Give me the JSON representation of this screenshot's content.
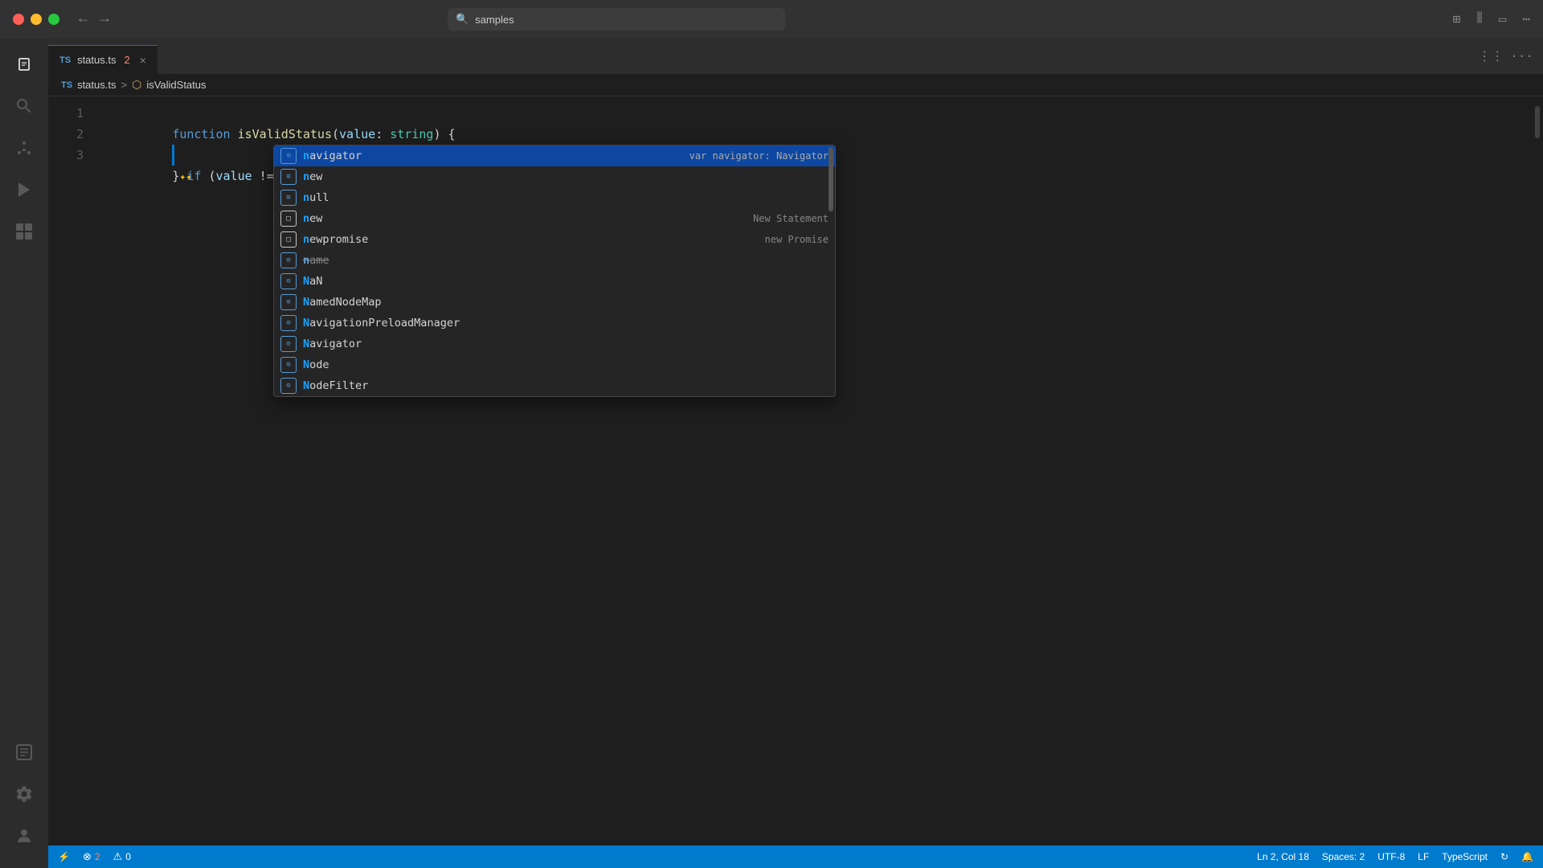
{
  "titlebar": {
    "search_placeholder": "samples",
    "nav_back": "←",
    "nav_forward": "→"
  },
  "tab": {
    "ts_label": "TS",
    "filename": "status.ts",
    "dirty_marker": "2",
    "close": "×"
  },
  "breadcrumb": {
    "ts_label": "TS",
    "file": "status.ts",
    "sep": ">",
    "func": "isValidStatus"
  },
  "editor": {
    "lines": [
      {
        "num": "1",
        "content": "function_line"
      },
      {
        "num": "2",
        "content": "if_line"
      },
      {
        "num": "3",
        "content": "close_line"
      }
    ]
  },
  "autocomplete": {
    "items": [
      {
        "icon": "var",
        "icon_type": "var",
        "label": "navigator",
        "match": "n",
        "detail": "var navigator: Navigator",
        "selected": true
      },
      {
        "icon": "kw",
        "icon_type": "keyword",
        "label": "new",
        "match": "n",
        "detail": "",
        "selected": false
      },
      {
        "icon": "kw",
        "icon_type": "keyword",
        "label": "null",
        "match": "n",
        "detail": "",
        "selected": false
      },
      {
        "icon": "snip",
        "icon_type": "snippet",
        "label": "new",
        "match": "n",
        "detail": "New Statement",
        "selected": false
      },
      {
        "icon": "snip",
        "icon_type": "snippet",
        "label": "newpromise",
        "match": "n",
        "detail": "new Promise",
        "selected": false
      },
      {
        "icon": "var",
        "icon_type": "var",
        "label": "name",
        "match": "n",
        "detail": "",
        "selected": false,
        "strikethrough": true
      },
      {
        "icon": "var",
        "icon_type": "var",
        "label": "NaN",
        "match": "n",
        "detail": "",
        "selected": false
      },
      {
        "icon": "var",
        "icon_type": "var",
        "label": "NamedNodeMap",
        "match": "n",
        "detail": "",
        "selected": false
      },
      {
        "icon": "var",
        "icon_type": "var",
        "label": "NavigationPreloadManager",
        "match": "n",
        "detail": "",
        "selected": false
      },
      {
        "icon": "var",
        "icon_type": "var",
        "label": "Navigator",
        "match": "n",
        "detail": "",
        "selected": false
      },
      {
        "icon": "var",
        "icon_type": "var",
        "label": "Node",
        "match": "n",
        "detail": "",
        "selected": false
      },
      {
        "icon": "var",
        "icon_type": "var",
        "label": "NodeFilter",
        "match": "n",
        "detail": "",
        "selected": false
      }
    ]
  },
  "status_bar": {
    "errors": "2",
    "warnings": "0",
    "position": "Ln 2, Col 18",
    "spaces": "Spaces: 2",
    "encoding": "UTF-8",
    "eol": "LF",
    "language": "TypeScript"
  },
  "activity": {
    "icons": [
      "files",
      "search",
      "source-control",
      "run",
      "extensions",
      "log"
    ]
  },
  "bottom_left": {
    "remote": "⚡ 2",
    "bell": "🔔"
  }
}
